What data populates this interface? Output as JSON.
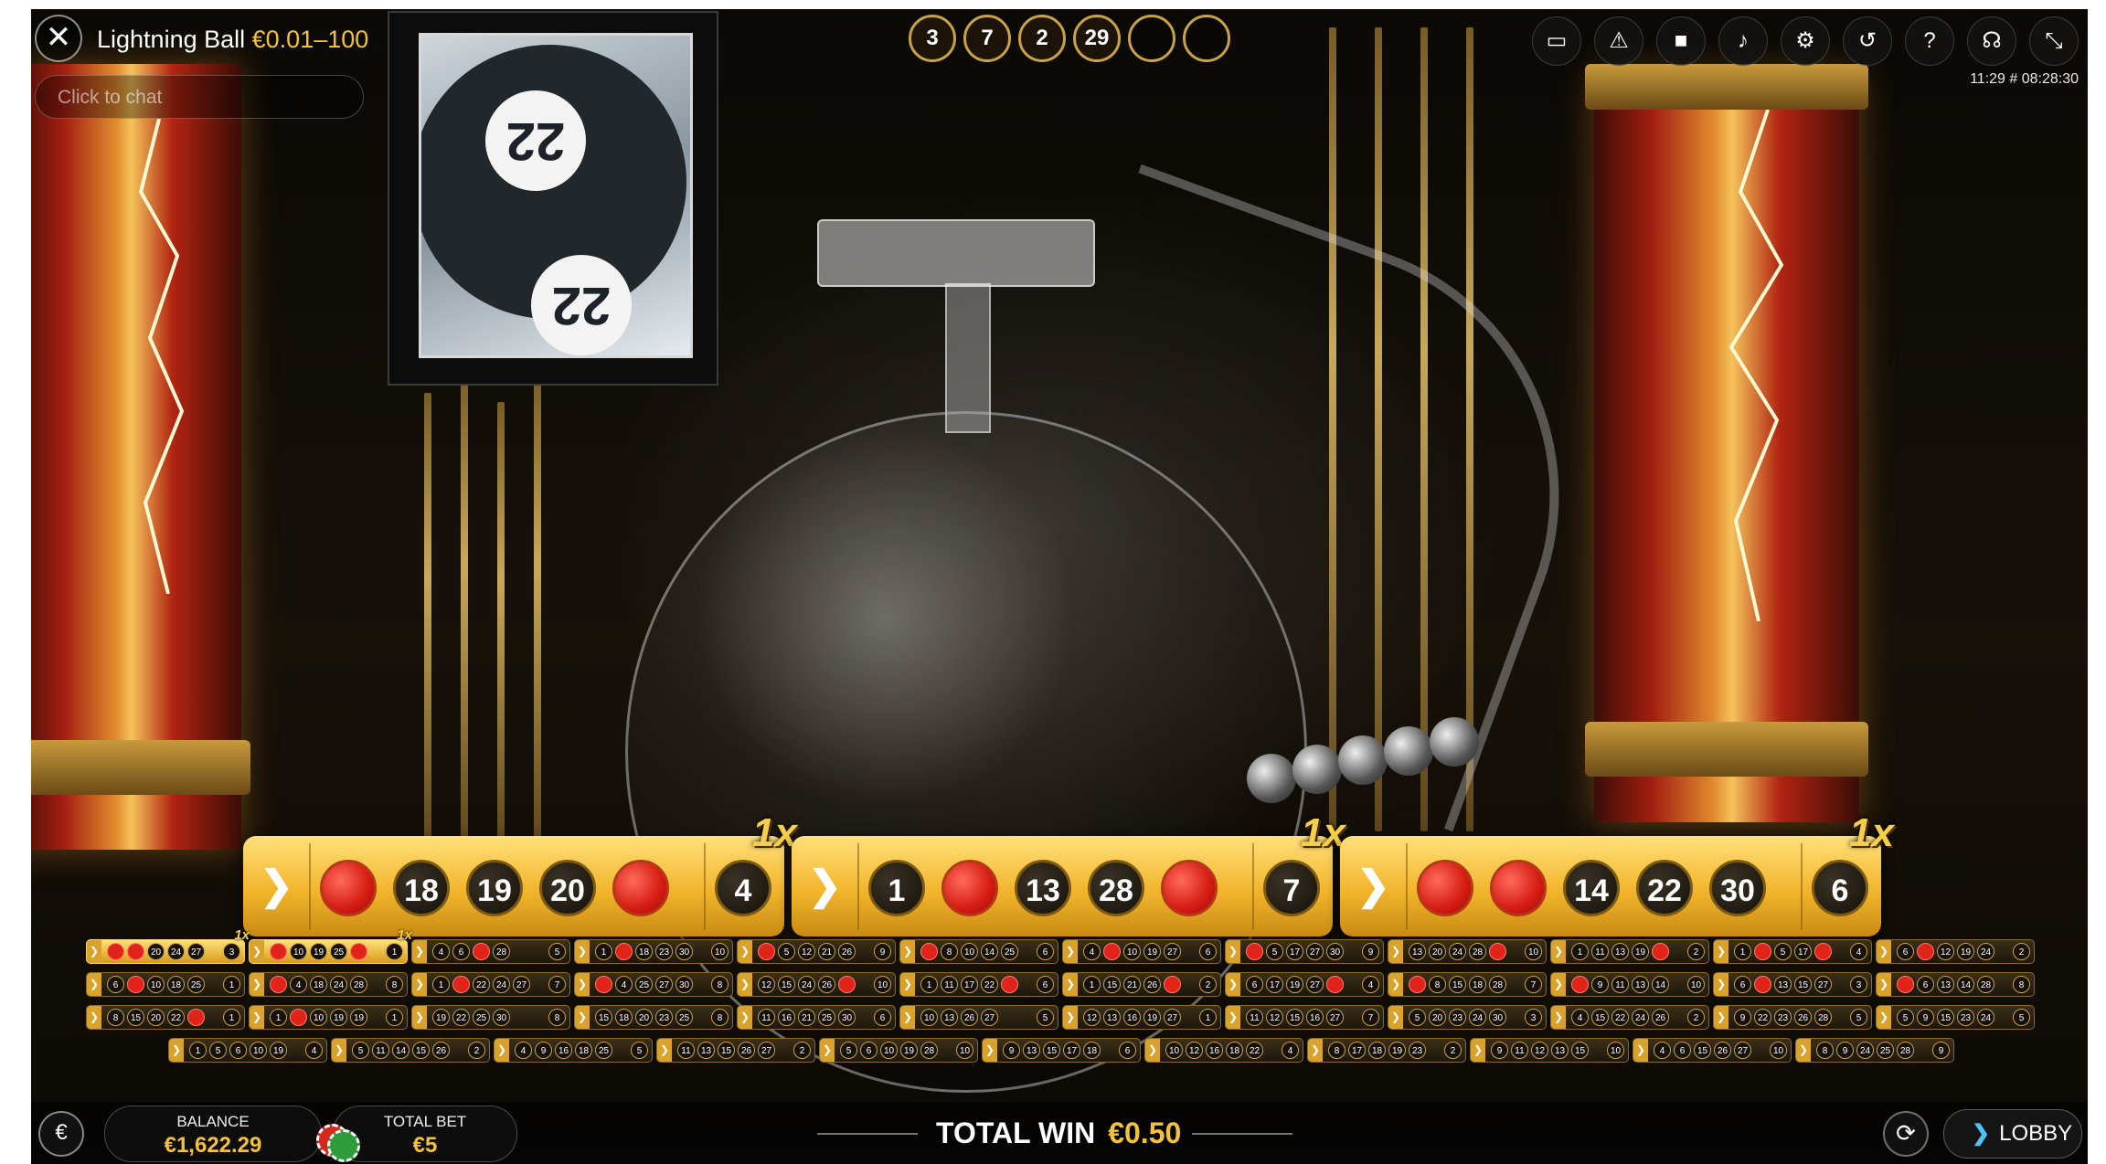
{
  "header": {
    "game_name": "Lightning Ball",
    "bet_range": "€0.01–100",
    "chat_placeholder": "Click to chat",
    "clock": "11:29 # 08:28:30"
  },
  "camera_ball_number": "22",
  "drawn_balls": [
    "3",
    "7",
    "2",
    "29",
    "",
    ""
  ],
  "toolbar_icons": [
    "chat-icon",
    "warning-icon",
    "video-icon",
    "volume-icon",
    "settings-icon",
    "history-icon",
    "help-icon",
    "support-icon",
    "minimize-icon"
  ],
  "big_cards": [
    {
      "multiplier": "1x",
      "balls": [
        {
          "n": "",
          "red": true
        },
        {
          "n": "18"
        },
        {
          "n": "19"
        },
        {
          "n": "20"
        },
        {
          "n": "",
          "red": true
        }
      ],
      "prize": "4"
    },
    {
      "multiplier": "1x",
      "balls": [
        {
          "n": "1"
        },
        {
          "n": "",
          "red": true
        },
        {
          "n": "13"
        },
        {
          "n": "28"
        },
        {
          "n": "",
          "red": true
        }
      ],
      "prize": "7"
    },
    {
      "multiplier": "1x",
      "balls": [
        {
          "n": "",
          "red": true
        },
        {
          "n": "",
          "red": true
        },
        {
          "n": "14"
        },
        {
          "n": "22"
        },
        {
          "n": "30"
        }
      ],
      "prize": "6"
    }
  ],
  "mini_rows": [
    [
      {
        "active": true,
        "mult": "1x",
        "balls": [
          "r",
          "r",
          "20",
          "24",
          "27"
        ],
        "prize": "3"
      },
      {
        "active": true,
        "mult": "1x",
        "balls": [
          "r",
          "10",
          "19",
          "25",
          "r"
        ],
        "prize": "1"
      },
      {
        "balls": [
          "4",
          "6",
          "r",
          "28"
        ],
        "prize": "5"
      },
      {
        "balls": [
          "1",
          "r",
          "18",
          "23",
          "30"
        ],
        "prize": "10"
      },
      {
        "balls": [
          "r",
          "5",
          "12",
          "21",
          "26"
        ],
        "prize": "9"
      },
      {
        "balls": [
          "r",
          "8",
          "10",
          "14",
          "25"
        ],
        "prize": "6"
      },
      {
        "balls": [
          "4",
          "r",
          "10",
          "19",
          "27"
        ],
        "prize": "6"
      },
      {
        "balls": [
          "r",
          "5",
          "17",
          "27",
          "30"
        ],
        "prize": "9"
      },
      {
        "balls": [
          "13",
          "20",
          "24",
          "28",
          "r"
        ],
        "prize": "10"
      },
      {
        "balls": [
          "1",
          "11",
          "13",
          "19",
          "r"
        ],
        "prize": "2"
      },
      {
        "balls": [
          "1",
          "r",
          "5",
          "17",
          "r"
        ],
        "prize": "4"
      },
      {
        "balls": [
          "6",
          "r",
          "12",
          "19",
          "24"
        ],
        "prize": "2"
      }
    ],
    [
      {
        "balls": [
          "6",
          "r",
          "10",
          "18",
          "25"
        ],
        "prize": "1"
      },
      {
        "balls": [
          "r",
          "4",
          "18",
          "24",
          "28"
        ],
        "prize": "8"
      },
      {
        "balls": [
          "1",
          "r",
          "22",
          "24",
          "27"
        ],
        "prize": "7"
      },
      {
        "balls": [
          "r",
          "4",
          "25",
          "27",
          "30"
        ],
        "prize": "8"
      },
      {
        "balls": [
          "12",
          "15",
          "24",
          "26",
          "r"
        ],
        "prize": "10"
      },
      {
        "balls": [
          "1",
          "11",
          "17",
          "22",
          "r"
        ],
        "prize": "6"
      },
      {
        "balls": [
          "1",
          "15",
          "21",
          "26",
          "r"
        ],
        "prize": "2"
      },
      {
        "balls": [
          "6",
          "17",
          "19",
          "27",
          "r"
        ],
        "prize": "4"
      },
      {
        "balls": [
          "r",
          "8",
          "15",
          "18",
          "28"
        ],
        "prize": "7"
      },
      {
        "balls": [
          "r",
          "9",
          "11",
          "13",
          "14"
        ],
        "prize": "10"
      },
      {
        "balls": [
          "6",
          "r",
          "13",
          "15",
          "27"
        ],
        "prize": "3"
      },
      {
        "balls": [
          "r",
          "6",
          "13",
          "14",
          "28"
        ],
        "prize": "8"
      }
    ],
    [
      {
        "balls": [
          "8",
          "15",
          "20",
          "22",
          "r"
        ],
        "prize": "1"
      },
      {
        "balls": [
          "1",
          "r",
          "10",
          "19",
          "19"
        ],
        "prize": "1"
      },
      {
        "balls": [
          "19",
          "22",
          "25",
          "30"
        ],
        "prize": "8"
      },
      {
        "balls": [
          "15",
          "18",
          "20",
          "23",
          "25"
        ],
        "prize": "8"
      },
      {
        "balls": [
          "11",
          "16",
          "21",
          "25",
          "30"
        ],
        "prize": "6"
      },
      {
        "balls": [
          "10",
          "13",
          "26",
          "27"
        ],
        "prize": "5"
      },
      {
        "balls": [
          "12",
          "13",
          "16",
          "19",
          "27"
        ],
        "prize": "1"
      },
      {
        "balls": [
          "11",
          "12",
          "15",
          "16",
          "27"
        ],
        "prize": "7"
      },
      {
        "balls": [
          "5",
          "20",
          "23",
          "24",
          "30"
        ],
        "prize": "3"
      },
      {
        "balls": [
          "4",
          "15",
          "22",
          "24",
          "26"
        ],
        "prize": "2"
      },
      {
        "balls": [
          "9",
          "22",
          "23",
          "26",
          "28"
        ],
        "prize": "5"
      },
      {
        "balls": [
          "5",
          "9",
          "15",
          "23",
          "24"
        ],
        "prize": "5"
      }
    ],
    [
      {
        "balls": [
          "1",
          "5",
          "6",
          "10",
          "19"
        ],
        "prize": "4"
      },
      {
        "balls": [
          "5",
          "11",
          "14",
          "15",
          "26"
        ],
        "prize": "2"
      },
      {
        "balls": [
          "4",
          "9",
          "16",
          "18",
          "25"
        ],
        "prize": "5"
      },
      {
        "balls": [
          "11",
          "13",
          "15",
          "26",
          "27"
        ],
        "prize": "2"
      },
      {
        "balls": [
          "5",
          "6",
          "10",
          "19",
          "28"
        ],
        "prize": "10"
      },
      {
        "balls": [
          "9",
          "13",
          "15",
          "17",
          "18"
        ],
        "prize": "6"
      },
      {
        "balls": [
          "10",
          "12",
          "16",
          "18",
          "22"
        ],
        "prize": "4"
      },
      {
        "balls": [
          "8",
          "17",
          "18",
          "19",
          "23"
        ],
        "prize": "2"
      },
      {
        "balls": [
          "9",
          "11",
          "12",
          "13",
          "15"
        ],
        "prize": "10"
      },
      {
        "balls": [
          "4",
          "6",
          "15",
          "26",
          "27"
        ],
        "prize": "10"
      },
      {
        "balls": [
          "8",
          "9",
          "24",
          "25",
          "28"
        ],
        "prize": "9"
      }
    ]
  ],
  "footer": {
    "currency_symbol": "€",
    "balance_label": "BALANCE",
    "balance_value": "€1,622.29",
    "total_bet_label": "TOTAL BET",
    "total_bet_value": "€5",
    "total_win_label": "TOTAL WIN",
    "total_win_value": "€0.50",
    "lobby_label": "LOBBY"
  },
  "colors": {
    "gold": "#f2c23a",
    "red_ball": "#e0241a",
    "accent_blue": "#4fc3f7"
  }
}
